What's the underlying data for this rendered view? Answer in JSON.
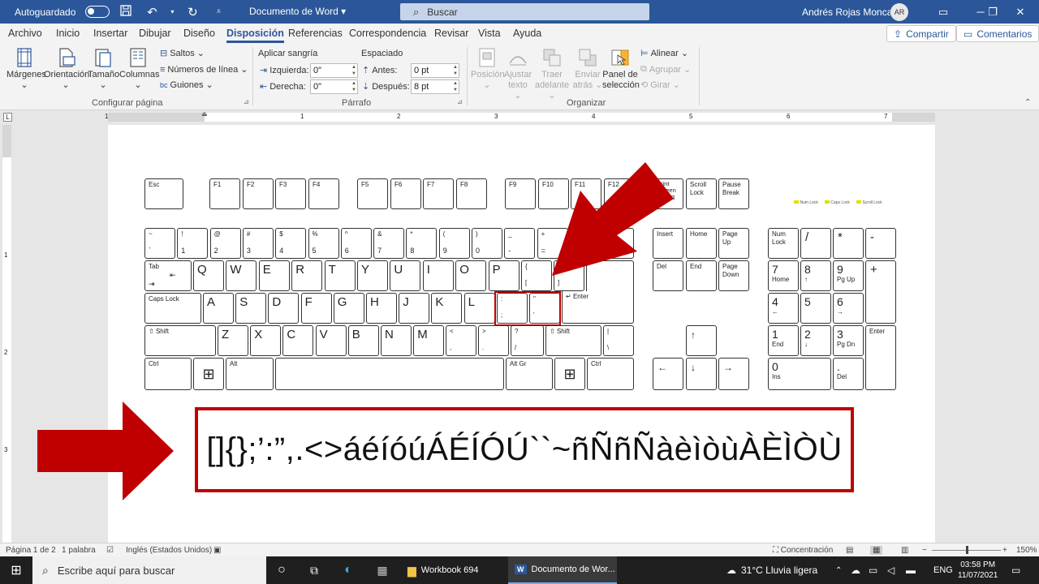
{
  "titlebar": {
    "autosave_label": "Autoguardado",
    "doc_name": "Documento de Word",
    "search_placeholder": "Buscar",
    "user_name": "Andrés Rojas Moncada",
    "user_initials": "AR"
  },
  "menu": {
    "tabs": [
      "Archivo",
      "Inicio",
      "Insertar",
      "Dibujar",
      "Diseño",
      "Disposición",
      "Referencias",
      "Correspondencia",
      "Revisar",
      "Vista",
      "Ayuda"
    ],
    "active_tab": "Disposición",
    "share_label": "Compartir",
    "comments_label": "Comentarios"
  },
  "ribbon": {
    "page_setup": {
      "margins": "Márgenes",
      "orientation": "Orientación",
      "size": "Tamaño",
      "columns": "Columnas",
      "breaks": "Saltos",
      "line_numbers": "Números de línea",
      "hyphenation": "Guiones",
      "group_label": "Configurar página"
    },
    "paragraph": {
      "indent_title": "Aplicar sangría",
      "spacing_title": "Espaciado",
      "left_label": "Izquierda:",
      "right_label": "Derecha:",
      "before_label": "Antes:",
      "after_label": "Después:",
      "left_value": "0\"",
      "right_value": "0\"",
      "before_value": "0 pt",
      "after_value": "8 pt",
      "group_label": "Párrafo"
    },
    "arrange": {
      "position": "Posición",
      "wrap_text_1": "Ajustar",
      "wrap_text_2": "texto",
      "bring_forward_1": "Traer",
      "bring_forward_2": "adelante",
      "send_backward_1": "Enviar",
      "send_backward_2": "atrás",
      "selection_pane_1": "Panel de",
      "selection_pane_2": "selección",
      "align": "Alinear",
      "group": "Agrupar",
      "rotate": "Girar",
      "group_label": "Organizar"
    }
  },
  "ruler_numbers": [
    "1",
    "1",
    "2",
    "3",
    "4",
    "5",
    "6",
    "7"
  ],
  "vruler_numbers": [
    "1",
    "2",
    "3"
  ],
  "keyboard": {
    "esc": "Esc",
    "f_keys": [
      "F1",
      "F2",
      "F3",
      "F4",
      "F5",
      "F6",
      "F7",
      "F8",
      "F9",
      "F10",
      "F11",
      "F12"
    ],
    "print_screen": "Print Screen SysRq",
    "scroll_lock": "Scroll Lock",
    "pause": "Pause Break",
    "indicators": [
      "Num Lock",
      "Caps Lock",
      "Scroll Lock"
    ],
    "number_row": [
      [
        "~",
        "`"
      ],
      [
        "!",
        "1"
      ],
      [
        "@",
        "2"
      ],
      [
        "#",
        "3"
      ],
      [
        "$",
        "4"
      ],
      [
        "%",
        "5"
      ],
      [
        "^",
        "6"
      ],
      [
        "&",
        "7"
      ],
      [
        "*",
        "8"
      ],
      [
        "(",
        "9"
      ],
      [
        ")",
        "0"
      ],
      [
        "_",
        "-"
      ],
      [
        "+",
        "="
      ]
    ],
    "tab": "Tab",
    "qwerty_row": [
      "Q",
      "W",
      "E",
      "R",
      "T",
      "Y",
      "U",
      "I",
      "O",
      "P"
    ],
    "bracket_row": [
      [
        "{",
        "["
      ],
      [
        "}",
        "]"
      ]
    ],
    "caps_lock": "Caps Lock",
    "home_row": [
      "A",
      "S",
      "D",
      "F",
      "G",
      "H",
      "J",
      "K",
      "L"
    ],
    "semicolon_row": [
      [
        ":",
        ";"
      ],
      [
        "\"",
        "'"
      ]
    ],
    "enter": "Enter",
    "shift": "Shift",
    "bottom_row": [
      "Z",
      "X",
      "C",
      "V",
      "B",
      "N",
      "M"
    ],
    "punct_row": [
      [
        "<",
        ","
      ],
      [
        ">",
        "."
      ],
      [
        "?",
        "/"
      ]
    ],
    "pipe": [
      "|",
      "\\"
    ],
    "ctrl": "Ctrl",
    "alt": "Alt",
    "alt_gr": "Alt Gr",
    "insert": "Insert",
    "home": "Home",
    "page_up": "Page Up",
    "delete": "Del",
    "end": "End",
    "page_down": "Page Down",
    "num_lock": "Num Lock",
    "numpad_ops": [
      "/",
      "*",
      "-",
      "+"
    ],
    "numpad_enter": "Enter",
    "numpad": [
      [
        "7",
        "Home"
      ],
      [
        "8",
        "↑"
      ],
      [
        "9",
        "Pg Up"
      ],
      [
        "4",
        "←"
      ],
      [
        "5",
        ""
      ],
      [
        "6",
        "→"
      ],
      [
        "1",
        "End"
      ],
      [
        "2",
        "↓"
      ],
      [
        "3",
        "Pg Dn"
      ],
      [
        "0",
        "Ins"
      ],
      [
        ".",
        "Del"
      ]
    ]
  },
  "special_chars": "[]{};’:”,.<>áéíóúÁÉÍÓÚ``~ñÑñÑàèìòùÀÈÌÒÙ",
  "statusbar": {
    "page": "Página 1 de 2",
    "words": "1 palabra",
    "language": "Inglés (Estados Unidos)",
    "focus": "Concentración",
    "zoom": "150%"
  },
  "taskbar": {
    "search_placeholder": "Escribe aquí para buscar",
    "apps": [
      "Workbook 694",
      "Documento de Wor..."
    ],
    "weather": "31°C  Lluvia ligera",
    "language": "ENG",
    "time": "03:58 PM",
    "date": "11/07/2021"
  },
  "colors": {
    "word_blue": "#2b579a",
    "arrow_red": "#c00000"
  }
}
